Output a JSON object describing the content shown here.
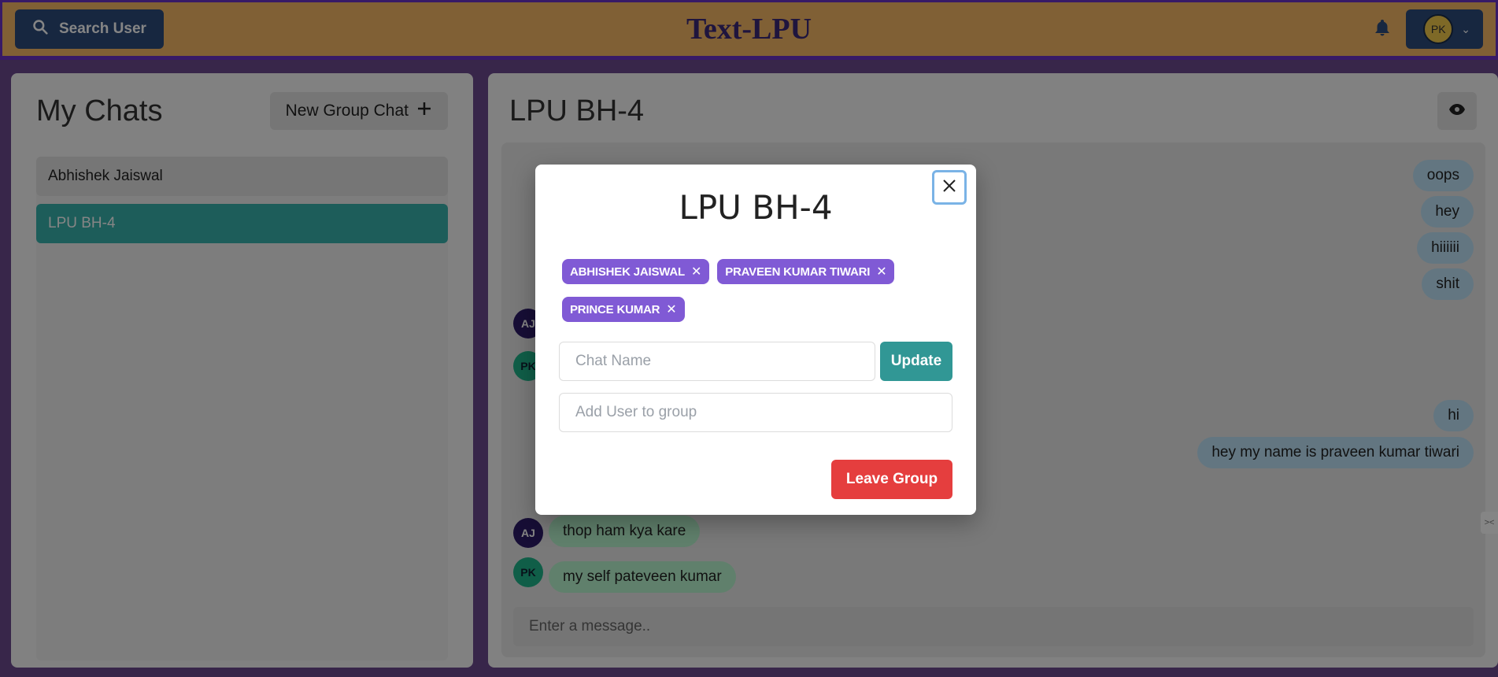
{
  "topbar": {
    "search_label": "Search User",
    "brand": "Text-LPU",
    "profile_initials": "PK"
  },
  "sidebar": {
    "title": "My Chats",
    "new_group_label": "New Group Chat",
    "chats": [
      {
        "name": "Abhishek Jaiswal",
        "active": false
      },
      {
        "name": "LPU BH-4",
        "active": true
      }
    ]
  },
  "chat": {
    "title": "LPU BH-4",
    "messages": [
      {
        "side": "right",
        "text": "oops"
      },
      {
        "side": "right",
        "text": "hey"
      },
      {
        "side": "right",
        "text": "hiiiiii"
      },
      {
        "side": "right",
        "text": "shit"
      },
      {
        "side": "left",
        "avatar": "AJ"
      },
      {
        "side": "left",
        "avatar": "PK"
      },
      {
        "side": "right",
        "text": "hi"
      },
      {
        "side": "right",
        "text": "hey my name is praveen kumar tiwari"
      },
      {
        "side": "left",
        "avatar": "AJ",
        "text": "thop ham kya kare"
      },
      {
        "side": "left",
        "avatar": "PK",
        "text": "my self pateveen kumar"
      }
    ],
    "input_placeholder": "Enter a message.."
  },
  "modal": {
    "title": "LPU BH-4",
    "members": [
      "ABHISHEK JAISWAL",
      "PRAVEEN KUMAR TIWARI",
      "PRINCE KUMAR"
    ],
    "chat_name_placeholder": "Chat Name",
    "update_label": "Update",
    "add_user_placeholder": "Add User to group",
    "leave_label": "Leave Group"
  },
  "colors": {
    "topbar_bg": "#f6b966",
    "topbar_border": "#6a32c4",
    "button_navy": "#2d4c7c",
    "active_chat": "#38b2ac",
    "badge": "#805ad5",
    "update": "#319795",
    "leave": "#e53e3e",
    "bubble_right": "#bee3f8",
    "bubble_left": "#b9f5d0"
  },
  "icons": {
    "search": "search-icon",
    "bell": "bell-icon",
    "chevron": "chevron-down-icon",
    "plus": "plus-icon",
    "eye": "eye-icon",
    "close": "close-icon",
    "remove": "x-icon"
  }
}
